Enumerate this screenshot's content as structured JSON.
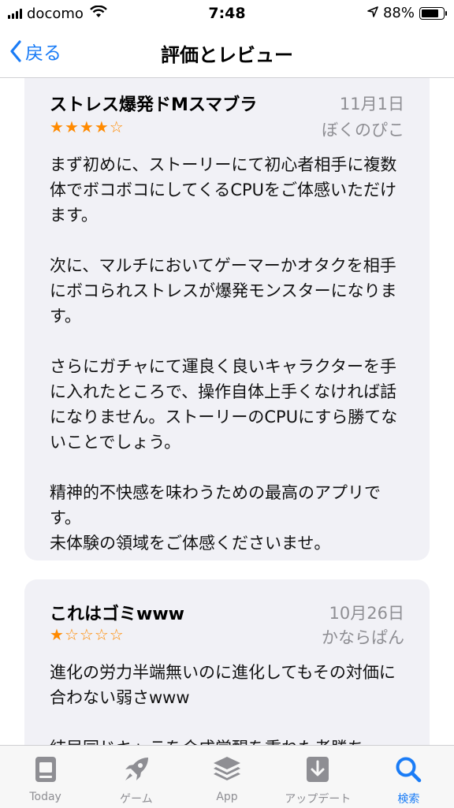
{
  "status_bar": {
    "carrier": "docomo",
    "time": "7:48",
    "battery_percent": "88%",
    "battery_level": 0.88
  },
  "nav": {
    "back_label": "戻る",
    "title": "評価とレビュー"
  },
  "reviews": [
    {
      "title": "ストレス爆発ドMスマブラ",
      "date": "11月1日",
      "rating": 4,
      "max_rating": 5,
      "author": "ぼくのぴこ",
      "body": "まず初めに、ストーリーにて初心者相手に複数体でボコボコにしてくるCPUをご体感いただけます。\n\n次に、マルチにおいてゲーマーかオタクを相手にボコられストレスが爆発モンスターになります。\n\nさらにガチャにて運良く良いキャラクターを手に入れたところで、操作自体上手くなければ話になりません。ストーリーのCPUにすら勝てないことでしょう。\n\n精神的不快感を味わうための最高のアプリです。\n未体験の領域をご体感くださいませ。"
    },
    {
      "title": "これはゴミwww",
      "date": "10月26日",
      "rating": 1,
      "max_rating": 5,
      "author": "かならぱん",
      "body": "進化の労力半端無いのに進化してもその対価に合わない弱さwww\n\n結局同じキャラを合成覚醒を重ねた者勝ち"
    }
  ],
  "tab_bar": {
    "items": [
      {
        "label": "Today",
        "icon": "today-icon"
      },
      {
        "label": "ゲーム",
        "icon": "rocket-icon"
      },
      {
        "label": "App",
        "icon": "layers-icon"
      },
      {
        "label": "アップデート",
        "icon": "download-icon"
      },
      {
        "label": "検索",
        "icon": "search-icon"
      }
    ],
    "active_index": 4
  },
  "colors": {
    "accent": "#1a7cf6",
    "star": "#ff8a00",
    "card_background": "#f1f1f6",
    "secondary_text": "#8e8e93"
  }
}
